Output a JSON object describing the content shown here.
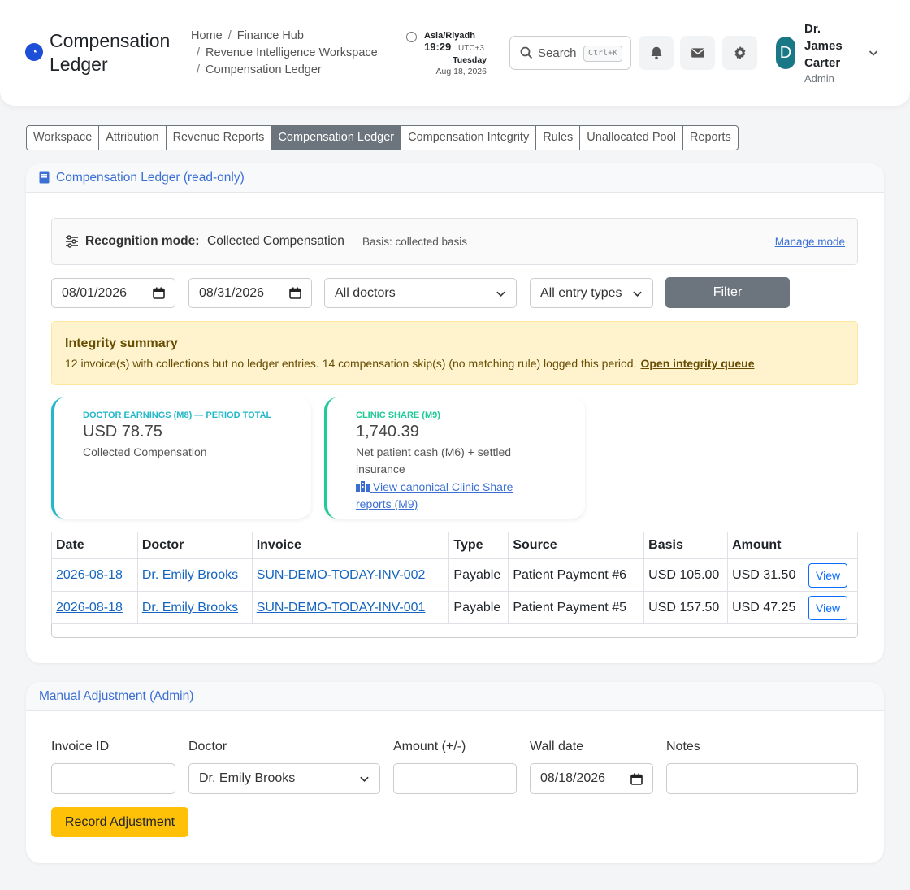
{
  "header": {
    "app_title": "Compensation Ledger",
    "breadcrumb": [
      "Home",
      "Finance Hub",
      "Revenue Intelligence Workspace",
      "Compensation Ledger"
    ],
    "clock": {
      "timezone": "Asia/Riyadh",
      "time": "19:29",
      "utc_offset": "UTC+3",
      "weekday": "Tuesday",
      "date": "Aug 18, 2026"
    },
    "search": {
      "label": "Search",
      "shortcut": "Ctrl+K"
    },
    "user": {
      "avatar_letter": "D",
      "name": "Dr. James Carter",
      "role": "Admin"
    }
  },
  "tabs": [
    {
      "label": "Workspace",
      "active": false
    },
    {
      "label": "Attribution",
      "active": false
    },
    {
      "label": "Revenue Reports",
      "active": false
    },
    {
      "label": "Compensation Ledger",
      "active": true
    },
    {
      "label": "Compensation Integrity",
      "active": false
    },
    {
      "label": "Rules",
      "active": false
    },
    {
      "label": "Unallocated Pool",
      "active": false
    },
    {
      "label": "Reports",
      "active": false
    }
  ],
  "ledger_card": {
    "title": "Compensation Ledger (read-only)",
    "mode": {
      "label": "Recognition mode:",
      "value": "Collected Compensation",
      "basis": "Basis: collected basis",
      "manage_link": "Manage mode"
    },
    "filters": {
      "date_from": "08/01/2026",
      "date_to": "08/31/2026",
      "doctor": "All doctors",
      "entry_type": "All entry types",
      "filter_button": "Filter"
    },
    "integrity": {
      "heading": "Integrity summary",
      "text": "12 invoice(s) with collections but no ledger entries. 14 compensation skip(s) (no matching rule) logged this period.",
      "link": "Open integrity queue"
    },
    "stats": [
      {
        "key": "Doctor Earnings (M8) — Period Total",
        "value": "USD 78.75",
        "sub": "Collected Compensation",
        "color": "#22b8c8"
      },
      {
        "key": "Clinic Share (M9)",
        "value": "1,740.39",
        "sub": "Net patient cash (M6) + settled insurance",
        "link": "View canonical Clinic Share reports (M9)",
        "color": "#20c997"
      }
    ],
    "table": {
      "columns": [
        "Date",
        "Doctor",
        "Invoice",
        "Type",
        "Source",
        "Basis",
        "Amount",
        ""
      ],
      "rows": [
        {
          "date": "2026-08-18",
          "doctor": "Dr. Emily Brooks",
          "invoice": "SUN-DEMO-TODAY-INV-002",
          "type": "Payable",
          "source": "Patient Payment #6",
          "basis": "USD 105.00",
          "amount": "USD 31.50",
          "action": "View"
        },
        {
          "date": "2026-08-18",
          "doctor": "Dr. Emily Brooks",
          "invoice": "SUN-DEMO-TODAY-INV-001",
          "type": "Payable",
          "source": "Patient Payment #5",
          "basis": "USD 157.50",
          "amount": "USD 47.25",
          "action": "View"
        }
      ]
    }
  },
  "adjustment_card": {
    "title": "Manual Adjustment (Admin)",
    "labels": {
      "invoice_id": "Invoice ID",
      "doctor": "Doctor",
      "amount": "Amount (+/-)",
      "wall_date": "Wall date",
      "notes": "Notes"
    },
    "values": {
      "invoice_id": "",
      "doctor": "Dr. Emily Brooks",
      "amount": "",
      "wall_date": "08/18/2026",
      "notes": ""
    },
    "submit": "Record Adjustment"
  },
  "colors": {
    "accent": "#3b6fd4",
    "active_tab": "#6c757d",
    "warning_bg": "#fff3cd",
    "primary_btn": "#ffc107",
    "avatar": "#1a7886"
  }
}
